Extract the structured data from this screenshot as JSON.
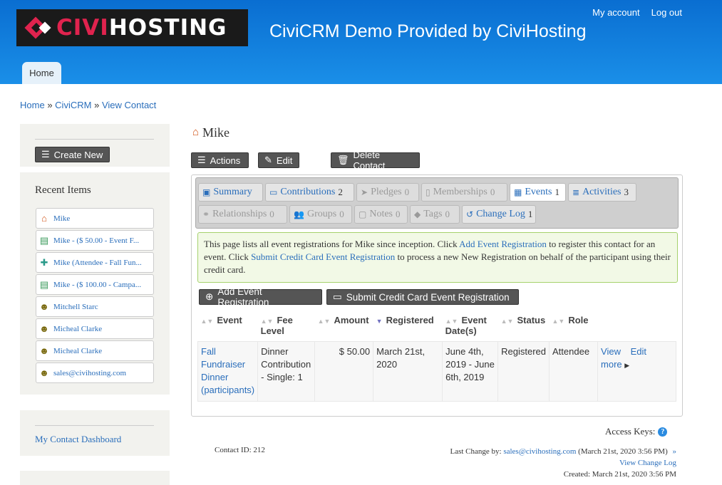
{
  "header": {
    "logo": {
      "part1": "CIVI",
      "part2": "HOSTING"
    },
    "site_title": "CiviCRM Demo Provided by CiviHosting",
    "user_links": [
      "My account",
      "Log out"
    ],
    "home_tab": "Home"
  },
  "breadcrumb": [
    "Home",
    "CiviCRM",
    "View Contact"
  ],
  "breadcrumb_sep": "»",
  "sidebar": {
    "create_new": "Create New",
    "recent_title": "Recent Items",
    "recent_items": [
      {
        "label": "Mike",
        "icon": "house-icon"
      },
      {
        "label": "Mike - ($ 50.00 - Event F...",
        "icon": "contribution-icon"
      },
      {
        "label": "Mike (Attendee - Fall Fun...",
        "icon": "participant-icon"
      },
      {
        "label": "Mike - ($ 100.00 - Campa...",
        "icon": "contribution-icon"
      },
      {
        "label": "Mitchell Starc",
        "icon": "person-icon"
      },
      {
        "label": "Micheal Clarke",
        "icon": "person-icon"
      },
      {
        "label": "Micheal Clarke",
        "icon": "person-icon"
      },
      {
        "label": "sales@civihosting.com",
        "icon": "person-icon"
      }
    ],
    "dashboard_link": "My Contact Dashboard"
  },
  "contact": {
    "name": "Mike",
    "actions_label": "Actions",
    "edit_label": "Edit",
    "delete_label": "Delete Contact"
  },
  "tabs": [
    {
      "label": "Summary",
      "count": "",
      "state": "enabled",
      "icon": "summary-icon"
    },
    {
      "label": "Contributions",
      "count": "2",
      "state": "enabled",
      "icon": "credit-card-icon"
    },
    {
      "label": "Pledges",
      "count": "0",
      "state": "disabled",
      "icon": "paper-plane-icon"
    },
    {
      "label": "Memberships",
      "count": "0",
      "state": "disabled",
      "icon": "id-card-icon"
    },
    {
      "label": "Events",
      "count": "1",
      "state": "active",
      "icon": "calendar-icon"
    },
    {
      "label": "Activities",
      "count": "3",
      "state": "enabled",
      "icon": "list-icon"
    },
    {
      "label": "Relationships",
      "count": "0",
      "state": "disabled",
      "icon": "handshake-icon"
    },
    {
      "label": "Groups",
      "count": "0",
      "state": "disabled",
      "icon": "users-icon"
    },
    {
      "label": "Notes",
      "count": "0",
      "state": "disabled",
      "icon": "note-icon"
    },
    {
      "label": "Tags",
      "count": "0",
      "state": "disabled",
      "icon": "tag-icon"
    },
    {
      "label": "Change Log",
      "count": "1",
      "state": "enabled",
      "icon": "history-icon"
    }
  ],
  "info": {
    "t1": "This page lists all event registrations for Mike since inception. Click ",
    "link1": "Add Event Registration",
    "t2": " to register this contact for an event. Click ",
    "link2": "Submit Credit Card Event Registration",
    "t3": " to process a new New Registration on behalf of the participant using their credit card."
  },
  "buttons": {
    "add_event": "Add Event Registration",
    "submit_cc": "Submit Credit Card Event Registration"
  },
  "table": {
    "headers": [
      "Event",
      "Fee Level",
      "Amount",
      "Registered",
      "Event Date(s)",
      "Status",
      "Role"
    ],
    "rows": [
      {
        "event": "Fall Fundraiser Dinner (participants)",
        "fee_level": "Dinner Contribution - Single: 1",
        "amount": "$ 50.00",
        "registered": "March 21st, 2020",
        "event_dates": "June 4th, 2019 - June 6th, 2019",
        "status": "Registered",
        "role": "Attendee",
        "actions": [
          "View",
          "Edit",
          "more"
        ]
      }
    ]
  },
  "footer": {
    "access_keys": "Access Keys:",
    "contact_id": "Contact ID: 212",
    "last_change_label": "Last Change by:",
    "last_change_user": "sales@civihosting.com",
    "last_change_date": "(March 21st, 2020 3:56 PM)",
    "view_change_log": "View Change Log",
    "created": "Created: March 21st, 2020 3:56 PM"
  }
}
